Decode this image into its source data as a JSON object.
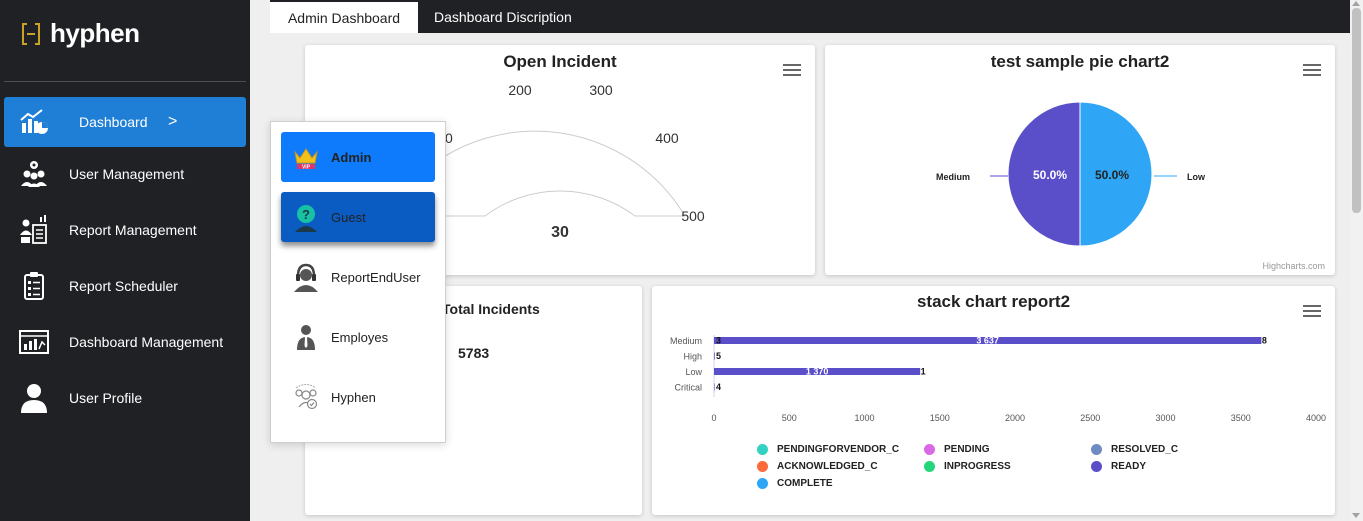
{
  "brand": {
    "name": "hyphen",
    "accent": "#c9a227"
  },
  "sidebar": {
    "items": [
      {
        "label": "Dashboard",
        "icon": "dashboard-chart-icon",
        "active": true,
        "chevron": ">"
      },
      {
        "label": "User Management",
        "icon": "user-gear-icon"
      },
      {
        "label": "Report Management",
        "icon": "report-management-icon"
      },
      {
        "label": "Report Scheduler",
        "icon": "clipboard-schedule-icon"
      },
      {
        "label": "Dashboard Management",
        "icon": "dashboard-board-icon"
      },
      {
        "label": "User Profile",
        "icon": "user-profile-icon"
      }
    ]
  },
  "tabs": [
    {
      "label": "Admin Dashboard",
      "active": true
    },
    {
      "label": "Dashboard Discription",
      "active": false
    }
  ],
  "role_menu": {
    "items": [
      {
        "label": "Admin",
        "icon": "crown-vip-icon",
        "state": "selected"
      },
      {
        "label": "Guest",
        "icon": "guest-question-icon",
        "state": "hover"
      },
      {
        "label": "ReportEndUser",
        "icon": "headset-user-icon"
      },
      {
        "label": "Employes",
        "icon": "employee-suit-icon"
      },
      {
        "label": "Hyphen",
        "icon": "hyphen-users-icon"
      }
    ]
  },
  "cards": {
    "open_incident": {
      "title": "Open Incident",
      "value": "30",
      "gauge": {
        "min": 0,
        "max": 500,
        "value": 30,
        "ticks": [
          "00",
          "200",
          "300",
          "400",
          "500"
        ]
      },
      "color": "#2ea6f5"
    },
    "pie": {
      "title": "test sample pie chart2",
      "credit": "Highcharts.com"
    },
    "total_incidents": {
      "title": "Total Incidents",
      "value": "5783"
    },
    "stack": {
      "title": "stack chart report2"
    }
  },
  "chart_data": [
    {
      "type": "pie",
      "title": "test sample pie chart2",
      "slices": [
        {
          "name": "Medium",
          "value": 50.0,
          "label": "50.0%",
          "color": "#5a4fc8"
        },
        {
          "name": "Low",
          "value": 50.0,
          "label": "50.0%",
          "color": "#2ea6f5"
        }
      ]
    },
    {
      "type": "bar",
      "orientation": "horizontal",
      "stacked": true,
      "title": "stack chart report2",
      "categories": [
        "Medium",
        "High",
        "Low",
        "Critical"
      ],
      "xlim": [
        0,
        4000
      ],
      "xticks": [
        "0",
        "500",
        "1000",
        "1500",
        "2000",
        "2500",
        "3000",
        "3500",
        "4000"
      ],
      "series": [
        {
          "name": "PENDINGFORVENDOR_C",
          "color": "#33d1c1",
          "values": [
            0,
            0,
            0,
            0
          ]
        },
        {
          "name": "PENDING",
          "color": "#d96ae6",
          "values": [
            0,
            0,
            0,
            0
          ]
        },
        {
          "name": "RESOLVED_C",
          "color": "#6f8bc4",
          "values": [
            0,
            0,
            0,
            0
          ]
        },
        {
          "name": "ACKNOWLEDGED_C",
          "color": "#fd6a3a",
          "values": [
            0,
            0,
            0,
            0
          ]
        },
        {
          "name": "INPROGRESS",
          "color": "#24d67a",
          "values": [
            0,
            0,
            0,
            0
          ]
        },
        {
          "name": "READY",
          "color": "#5a4fc8",
          "values": [
            3637,
            5,
            1370,
            4
          ]
        },
        {
          "name": "COMPLETE",
          "color": "#2ea6f5",
          "values": [
            0,
            0,
            0,
            0
          ]
        }
      ],
      "data_labels": [
        {
          "start": "3",
          "middle": "3 637",
          "end": "8"
        },
        {
          "start": "5",
          "middle": "",
          "end": ""
        },
        {
          "start": "",
          "middle": "1 370",
          "end": "1"
        },
        {
          "start": "4",
          "middle": "",
          "end": ""
        }
      ]
    }
  ]
}
